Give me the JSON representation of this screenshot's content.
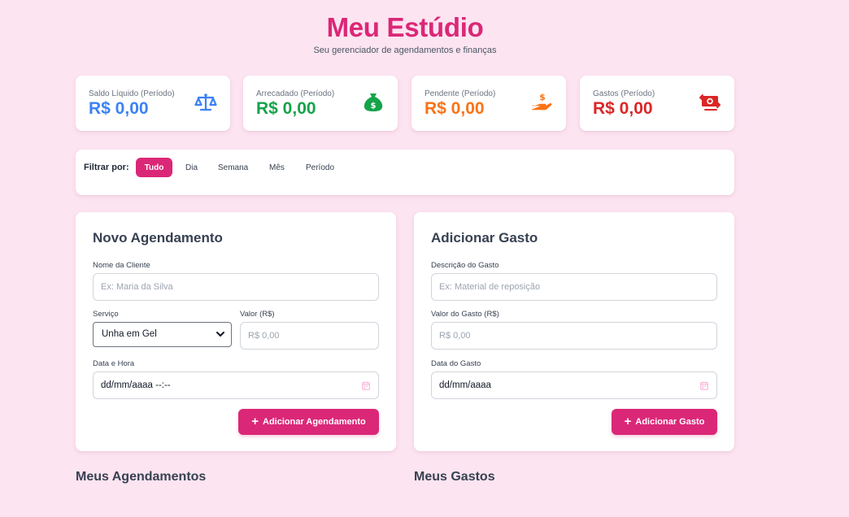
{
  "app": {
    "title": "Meu Estúdio",
    "subtitle": "Seu gerenciador de agendamentos e finanças"
  },
  "stats": [
    {
      "label": "Saldo Líquido (Período)",
      "value": "R$ 0,00",
      "color": "#3b82f6",
      "icon": "scale-icon"
    },
    {
      "label": "Arrecadado (Período)",
      "value": "R$ 0,00",
      "color": "#16a34a",
      "icon": "money-bag-icon"
    },
    {
      "label": "Pendente (Período)",
      "value": "R$ 0,00",
      "color": "#f97316",
      "icon": "hand-coin-icon"
    },
    {
      "label": "Gastos (Período)",
      "value": "R$ 0,00",
      "color": "#dc2626",
      "icon": "money-exchange-icon"
    }
  ],
  "filter": {
    "label": "Filtrar por:",
    "options": [
      "Tudo",
      "Dia",
      "Semana",
      "Mês",
      "Período"
    ],
    "active": "Tudo"
  },
  "appointment_form": {
    "title": "Novo Agendamento",
    "client_label": "Nome da Cliente",
    "client_placeholder": "Ex: Maria da Silva",
    "service_label": "Serviço",
    "service_value": "Unha em Gel",
    "value_label": "Valor (R$)",
    "value_placeholder": "R$ 0,00",
    "datetime_label": "Data e Hora",
    "datetime_value": "dd/mm/aaaa --:--",
    "submit_label": "Adicionar Agendamento"
  },
  "expense_form": {
    "title": "Adicionar Gasto",
    "description_label": "Descrição do Gasto",
    "description_placeholder": "Ex: Material de reposição",
    "value_label": "Valor do Gasto (R$)",
    "value_placeholder": "R$ 0,00",
    "date_label": "Data do Gasto",
    "date_value": "dd/mm/aaaa",
    "submit_label": "Adicionar Gasto"
  },
  "sections": {
    "appointments": "Meus Agendamentos",
    "expenses": "Meus Gastos"
  },
  "colors": {
    "accent": "#db2777",
    "background": "#fce4f1"
  }
}
